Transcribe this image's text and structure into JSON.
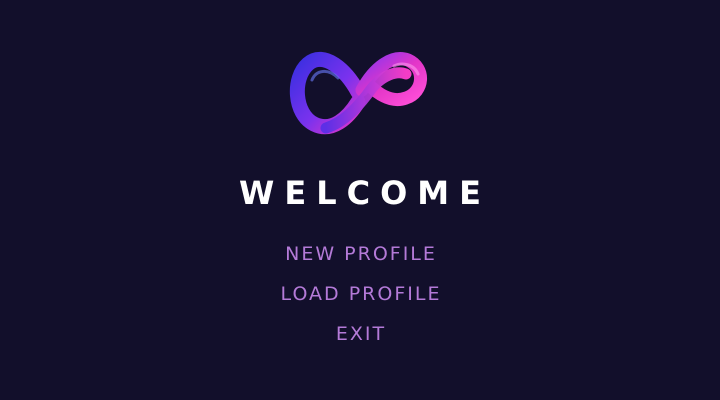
{
  "logo": {
    "icon": "infinity-icon",
    "colors": {
      "blue": "#3b2fe0",
      "violet": "#8a35f0",
      "magenta": "#e235c8",
      "pink": "#ff4fd8"
    }
  },
  "title": "WELCOME",
  "menu": {
    "items": [
      {
        "label": "NEW PROFILE"
      },
      {
        "label": "LOAD PROFILE"
      },
      {
        "label": "EXIT"
      }
    ]
  },
  "colors": {
    "background": "#120f2b",
    "title": "#ffffff",
    "menu_text": "#b47ad8"
  }
}
